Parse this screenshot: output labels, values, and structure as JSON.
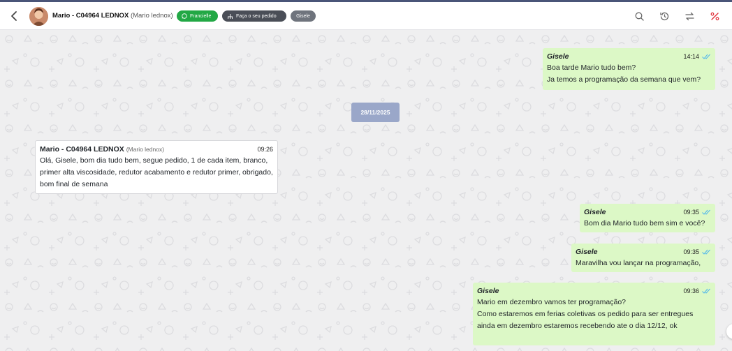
{
  "header": {
    "contact_name": "Mario - C04964 LEDNOX",
    "contact_sub": "(Mario lednox)",
    "tag_whatsapp": "Francielle",
    "tag_order": "Faça o seu pedido",
    "tag_agent": "Gisele",
    "icons": [
      "back-arrow-icon",
      "search-icon",
      "history-icon",
      "transfer-icon",
      "close-ticket-icon"
    ]
  },
  "date_separator": "28/11/2025",
  "messages": [
    {
      "author": "Gisele",
      "time": "14:14",
      "lines": [
        "Boa tarde Mario tudo bem?",
        "Ja temos a programação da semana que vem?"
      ]
    },
    {
      "author": "Mario - C04964 LEDNOX",
      "author_sub": "(Mario lednox)",
      "time": "09:26",
      "text": "Olá, Gisele, bom dia tudo bem, segue pedido, 1 de cada item, branco, primer alta viscosidade, redutor acabamento e redutor primer, obrigado, bom final de semana"
    },
    {
      "author": "Gisele",
      "time": "09:35",
      "lines": [
        "Bom dia Mario tudo bem sim e você?"
      ]
    },
    {
      "author": "Gisele",
      "time": "09:35",
      "lines": [
        "Maravilha vou lançar na programação,"
      ]
    },
    {
      "author": "Gisele",
      "time": "09:36",
      "lines": [
        "Mario em dezembro vamos ter programação?",
        "Como estaremos em ferias coletivas os pedido para ser entregues ainda em dezembro estaremos recebendo ate o dia 12/12, ok"
      ]
    }
  ],
  "colors": {
    "outgoing": "#dcf8c6",
    "incoming": "#ffffff",
    "whatsapp_green": "#22a845",
    "date_chip": "#9aa7c9",
    "read_ticks": "#4fb6ec"
  }
}
